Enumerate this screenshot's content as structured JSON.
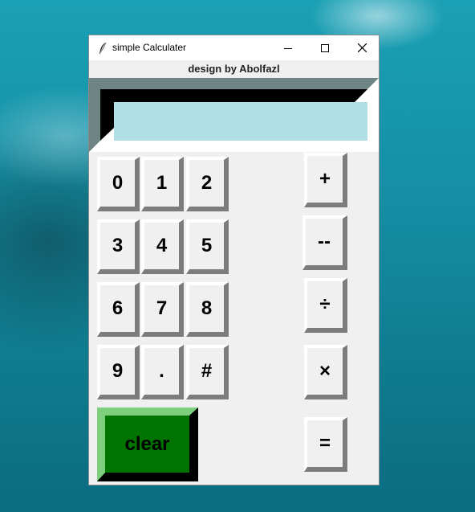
{
  "window": {
    "title": "simple Calculater",
    "subtitle": "design by Abolfazl"
  },
  "display": {
    "value": ""
  },
  "keys": {
    "0": "0",
    "1": "1",
    "2": "2",
    "3": "3",
    "4": "4",
    "5": "5",
    "6": "6",
    "7": "7",
    "8": "8",
    "9": "9",
    "dot": ".",
    "hash": "#",
    "clear": "clear",
    "plus": "+",
    "minus": "--",
    "divide": "÷",
    "multiply": "×",
    "equals": "="
  },
  "colors": {
    "display_background": "#b0dfe5",
    "clear_button": "#007300",
    "desktop": "#1690a6"
  },
  "icons": {
    "app": "feather-icon",
    "minimize": "minimize-icon",
    "maximize": "maximize-icon",
    "close": "close-icon"
  }
}
